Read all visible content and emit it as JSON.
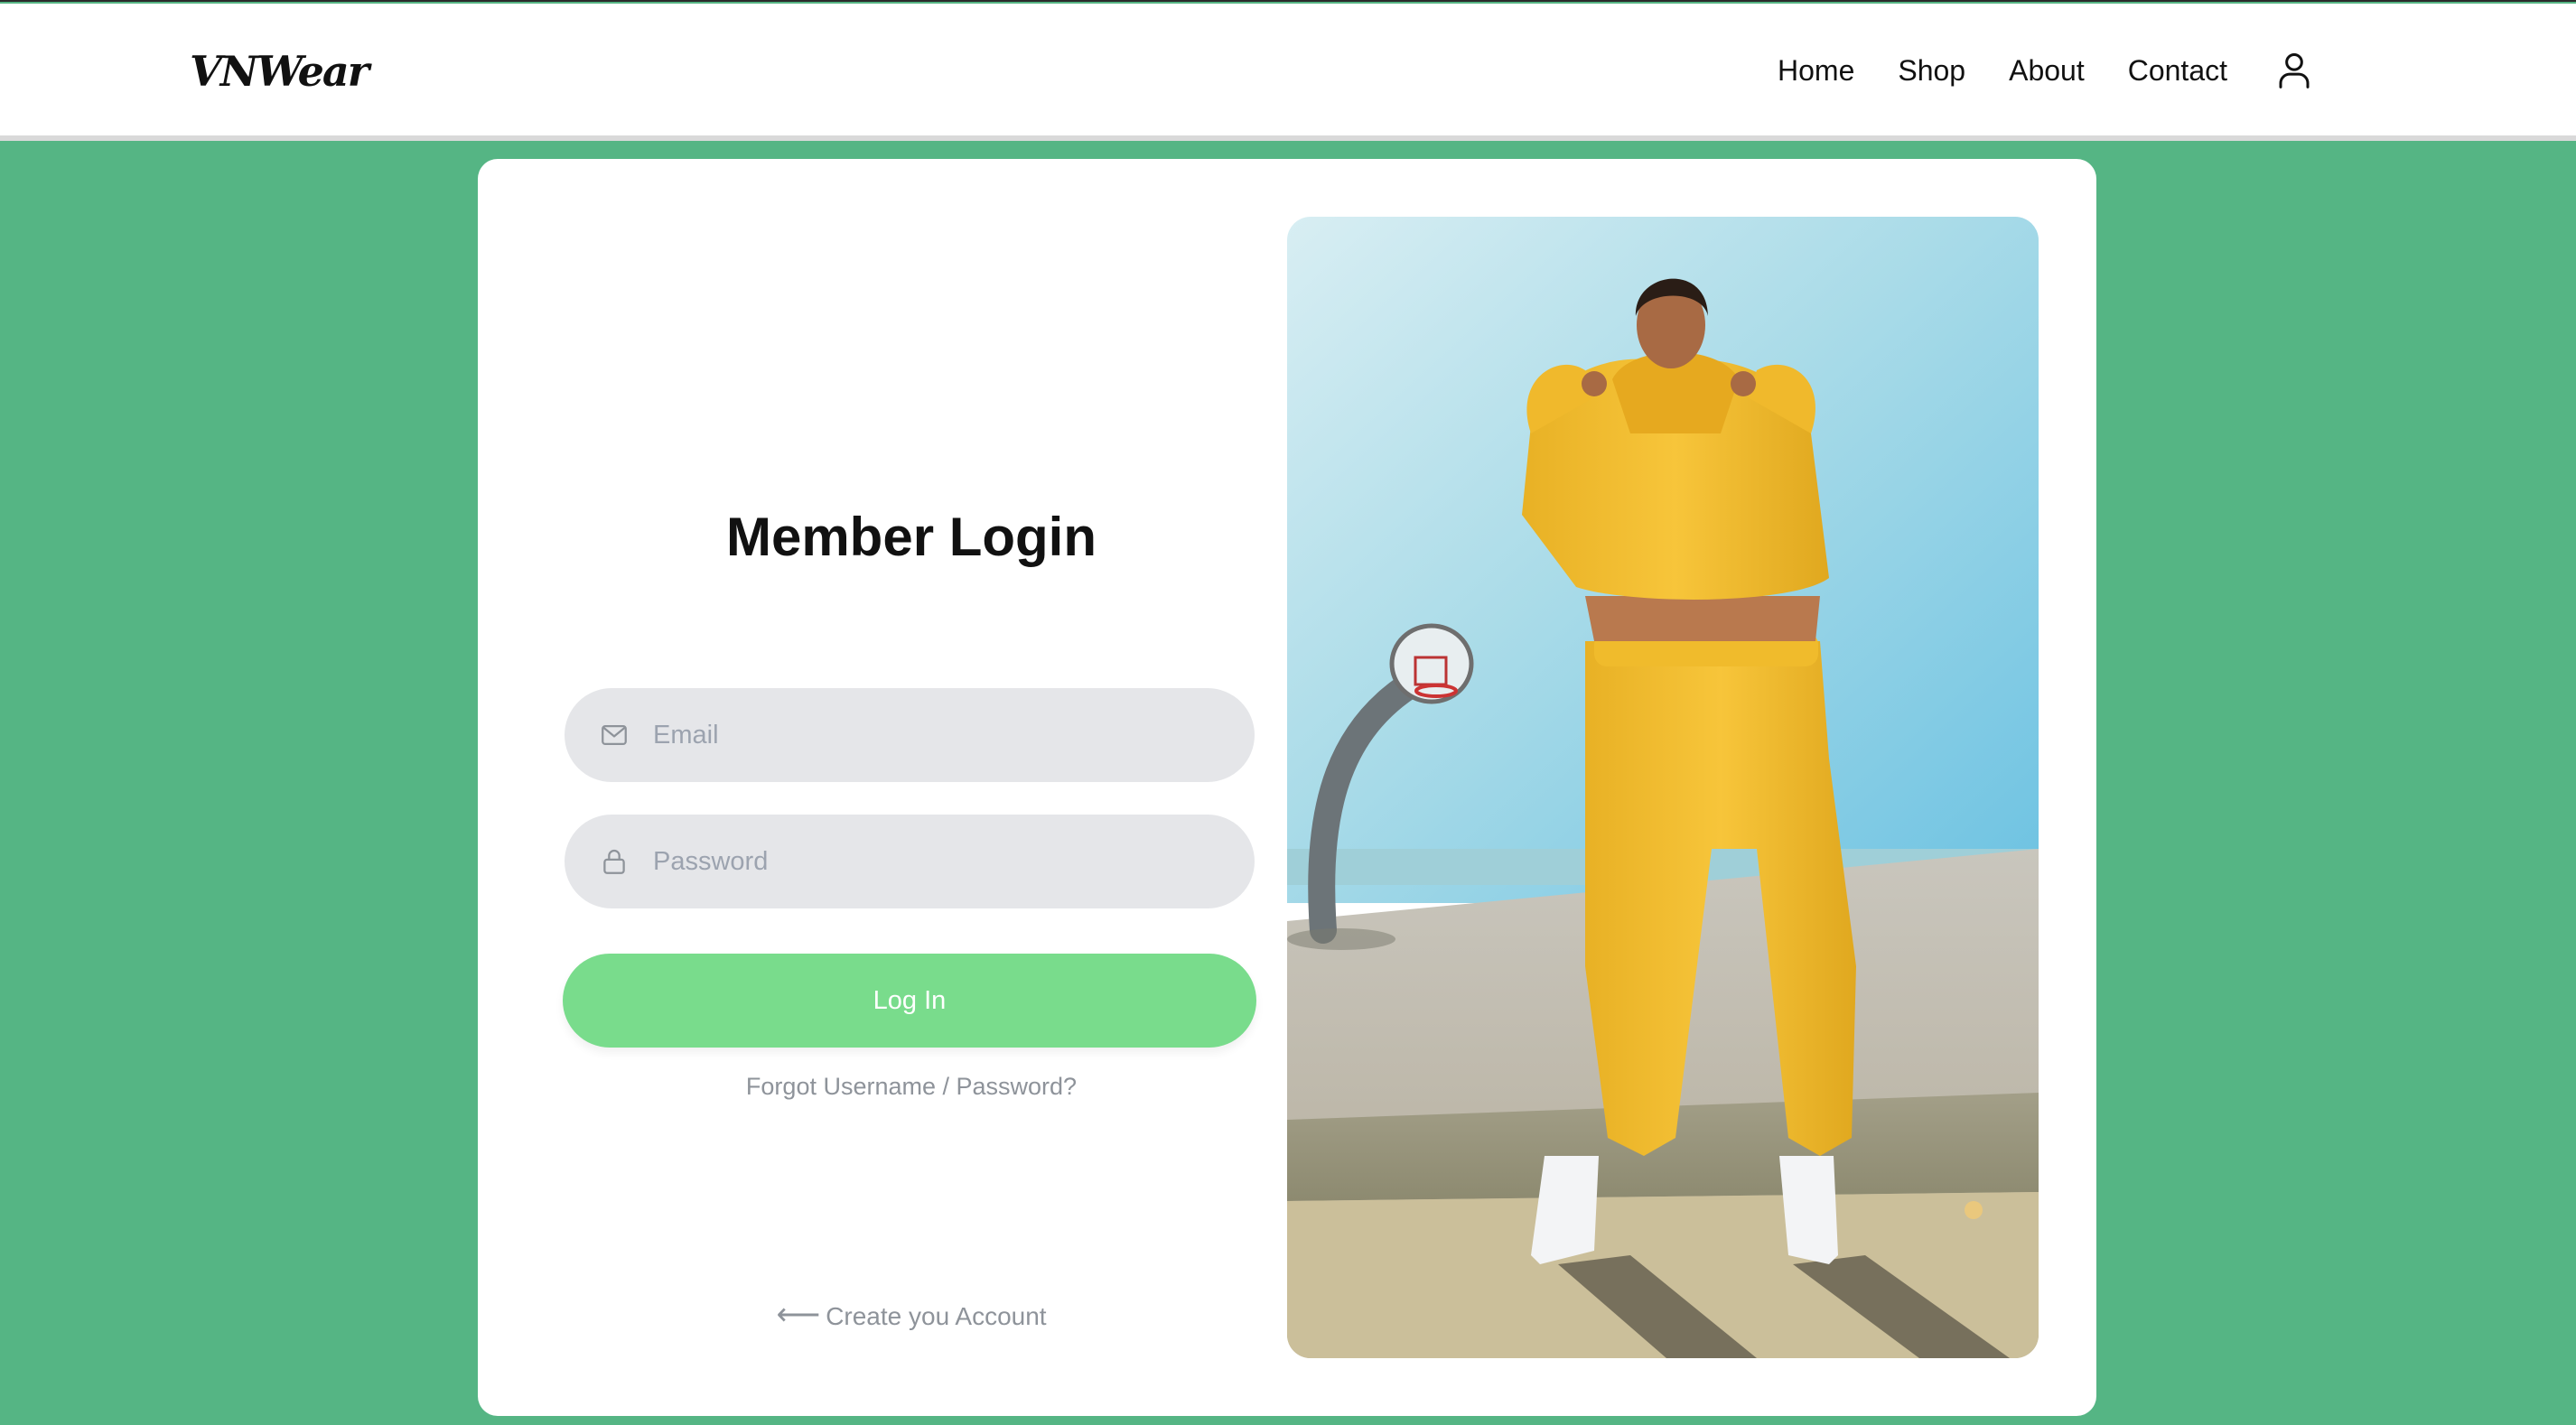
{
  "brand": {
    "logo_text": "VNWear"
  },
  "nav": {
    "links": [
      "Home",
      "Shop",
      "About",
      "Contact"
    ],
    "user_icon": "user-icon"
  },
  "login": {
    "title": "Member Login",
    "email": {
      "placeholder": "Email",
      "value": "",
      "icon": "mail-icon"
    },
    "password": {
      "placeholder": "Password",
      "value": "",
      "icon": "lock-icon"
    },
    "submit_label": "Log In",
    "forgot_label": "Forgot Username / Password?",
    "create_label": "Create you Account",
    "create_icon": "arrow-left-icon"
  },
  "hero_image": {
    "icon": "fashion-photo",
    "subject": "model in yellow hoodie and sweatpants on basketball court"
  },
  "colors": {
    "background": "#55b584",
    "button": "#79dc8c",
    "input_bg": "#e5e6e9",
    "muted_text": "#8e939a"
  }
}
